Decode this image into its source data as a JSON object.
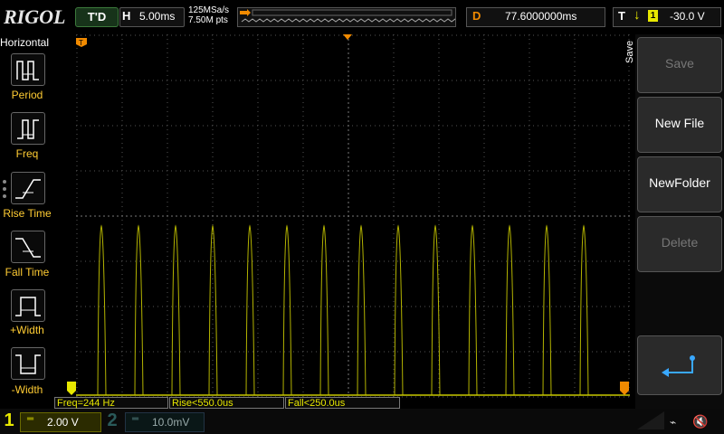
{
  "top": {
    "logo": "RIGOL",
    "run_state": "T'D",
    "horizontal_label": "H",
    "timebase": "5.00ms",
    "sample_rate": "125MSa/s",
    "memory_depth": "7.50M pts",
    "delay_label": "D",
    "delay_value": "77.6000000ms",
    "trigger_label": "T",
    "trigger_source": "1",
    "trigger_level": "-30.0 V"
  },
  "left_menu": {
    "title": "Horizontal",
    "items": [
      {
        "label": "Period",
        "icon": "period-icon"
      },
      {
        "label": "Freq",
        "icon": "freq-icon"
      },
      {
        "label": "Rise Time",
        "icon": "rise-time-icon"
      },
      {
        "label": "Fall Time",
        "icon": "fall-time-icon"
      },
      {
        "label": "+Width",
        "icon": "positive-width-icon"
      },
      {
        "label": "-Width",
        "icon": "negative-width-icon"
      }
    ]
  },
  "right_menu": {
    "title": "Save",
    "buttons": [
      {
        "label": "Save",
        "enabled": false
      },
      {
        "label": "New File",
        "enabled": true
      },
      {
        "label": "NewFolder",
        "enabled": true
      },
      {
        "label": "Delete",
        "enabled": false
      }
    ],
    "enter_icon": "enter-return-icon"
  },
  "measurements": {
    "freq": "Freq=244 Hz",
    "rise": "Rise<550.0us",
    "fall": "Fall<250.0us"
  },
  "channels": {
    "ch1_number": "1",
    "ch1_scale": "2.00 V",
    "ch2_number": "2",
    "ch2_scale": "10.0mV"
  },
  "colors": {
    "ch1": "#e8e800",
    "trigger_marker": "#f08a00",
    "ch2": "#2a5a5a"
  },
  "status_icons": [
    "usb-icon",
    "speaker-muted-icon"
  ]
}
